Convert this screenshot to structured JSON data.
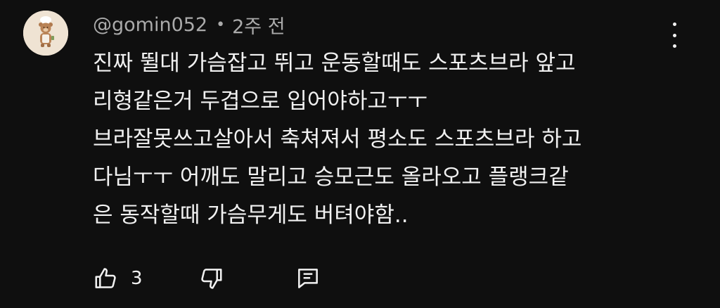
{
  "comment": {
    "author": "@gomin052",
    "separator": "•",
    "time": "2주 전",
    "lines": [
      "진짜 뛸대 가슴잡고 뛰고 운동할때도 스포츠브라 앞고",
      "리형같은거 두겹으로 입어야하고ㅜㅜ",
      "브라잘못쓰고살아서 축쳐져서 평소도 스포츠브라 하고",
      "다님ㅜㅜ  어깨도 말리고 승모근도 올라오고 플랭크같",
      "은 동작할때 가슴무게도 버텨야함.."
    ],
    "like_count": "3"
  },
  "icons": {
    "avatar": "avatar-bear-chef",
    "menu": "more-vertical-icon",
    "like": "thumbs-up-icon",
    "dislike": "thumbs-down-icon",
    "reply": "reply-comment-icon"
  },
  "colors": {
    "background": "#0f0f0f",
    "text": "#f1f1f1",
    "meta": "#aaaaaa"
  }
}
